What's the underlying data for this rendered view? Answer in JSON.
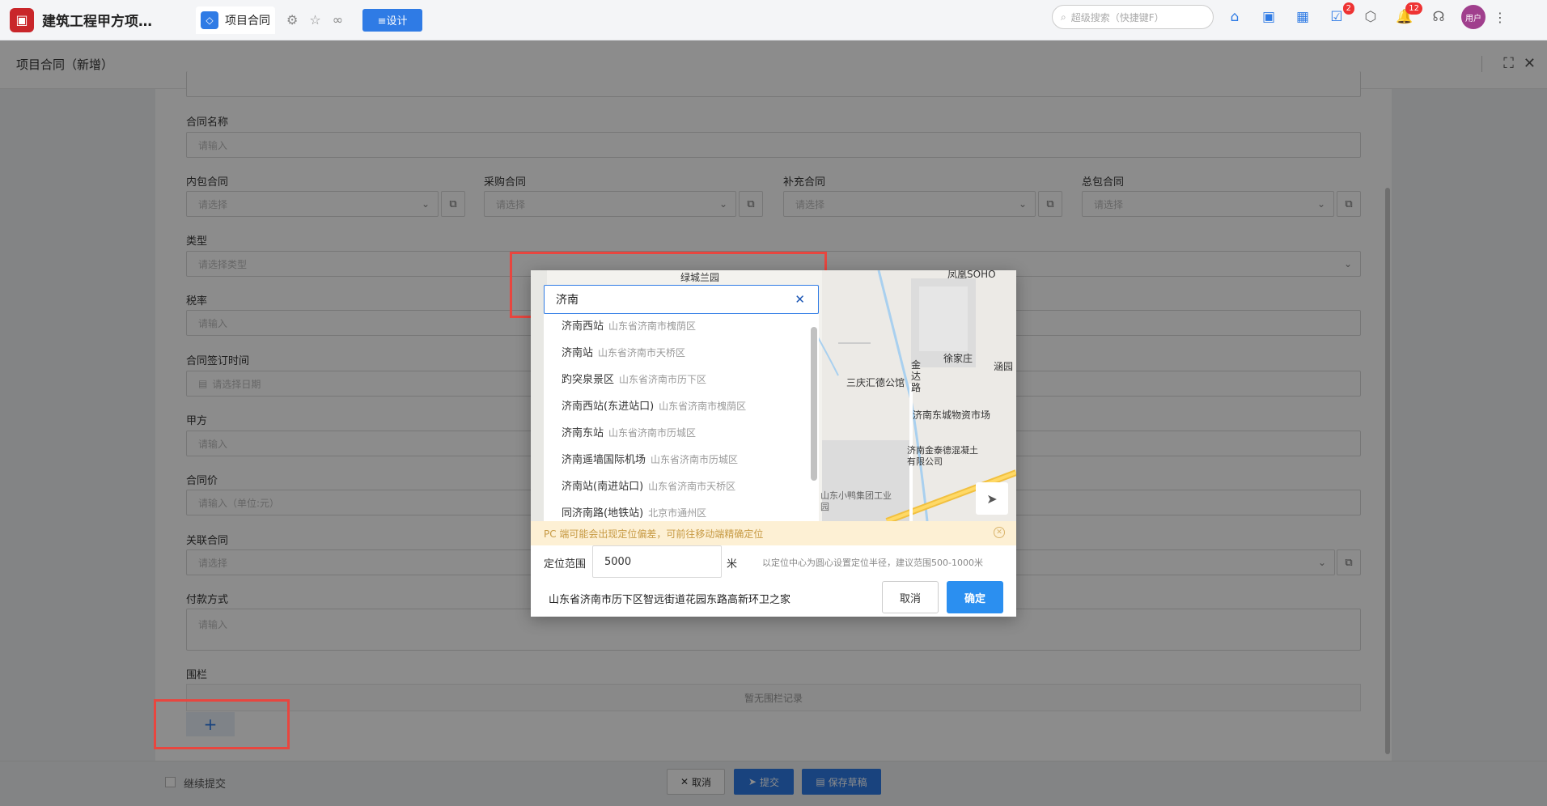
{
  "app": {
    "title": "建筑工程甲方项目..."
  },
  "tab": {
    "label": "项目合同"
  },
  "design_btn": "≡设计",
  "search": {
    "placeholder": "超级搜索（快捷键F）"
  },
  "badges": {
    "todo": "2",
    "notify": "12"
  },
  "user": {
    "name": "用户"
  },
  "sheet": {
    "title": "项目合同（新增）"
  },
  "form": {
    "contract_name": {
      "label": "合同名称",
      "placeholder": "请输入"
    },
    "inner_contract": {
      "label": "内包合同",
      "placeholder": "请选择"
    },
    "purchase_contract": {
      "label": "采购合同",
      "placeholder": "请选择"
    },
    "supplement_contract": {
      "label": "补充合同",
      "placeholder": "请选择"
    },
    "general_contract": {
      "label": "总包合同",
      "placeholder": "请选择"
    },
    "type": {
      "label": "类型",
      "placeholder": "请选择类型"
    },
    "tax_rate": {
      "label": "税率",
      "placeholder": "请输入"
    },
    "sign_date": {
      "label": "合同签订时间",
      "placeholder": "请选择日期"
    },
    "party_a": {
      "label": "甲方",
      "placeholder": "请输入"
    },
    "price": {
      "label": "合同价",
      "placeholder": "请输入（单位:元）"
    },
    "related_contract": {
      "label": "关联合同",
      "placeholder": "请选择"
    },
    "payment": {
      "label": "付款方式",
      "placeholder": "请输入"
    },
    "fence": {
      "label": "围栏",
      "empty": "暂无围栏记录"
    }
  },
  "footer": {
    "continue": "继续提交",
    "cancel": "取消",
    "submit": "提交",
    "save_draft": "保存草稿"
  },
  "map_dialog": {
    "search_value": "济南",
    "suggestions": [
      {
        "name": "济南西站",
        "district": "山东省济南市槐荫区"
      },
      {
        "name": "济南站",
        "district": "山东省济南市天桥区"
      },
      {
        "name": "趵突泉景区",
        "district": "山东省济南市历下区"
      },
      {
        "name": "济南西站(东进站口)",
        "district": "山东省济南市槐荫区"
      },
      {
        "name": "济南东站",
        "district": "山东省济南市历城区"
      },
      {
        "name": "济南遥墙国际机场",
        "district": "山东省济南市历城区"
      },
      {
        "name": "济南站(南进站口)",
        "district": "山东省济南市天桥区"
      },
      {
        "name": "同济南路(地铁站)",
        "district": "北京市通州区"
      }
    ],
    "map_labels": [
      "绿城兰园",
      "凤凰SOHO",
      "徐家庄",
      "三庆汇德公馆",
      "金达路",
      "济南东城物资市场",
      "济南金泰德混凝土有限公司",
      "山东小鸭集团工业园",
      "涵园"
    ],
    "warning": "PC 端可能会出现定位偏差，可前往移动端精确定位",
    "range_label": "定位范围",
    "range_value": "5000",
    "range_unit": "米",
    "range_hint": "以定位中心为圆心设置定位半径，建议范围500-1000米",
    "address": "山东省济南市历下区智远街道花园东路高新环卫之家",
    "cancel": "取消",
    "confirm": "确定"
  }
}
